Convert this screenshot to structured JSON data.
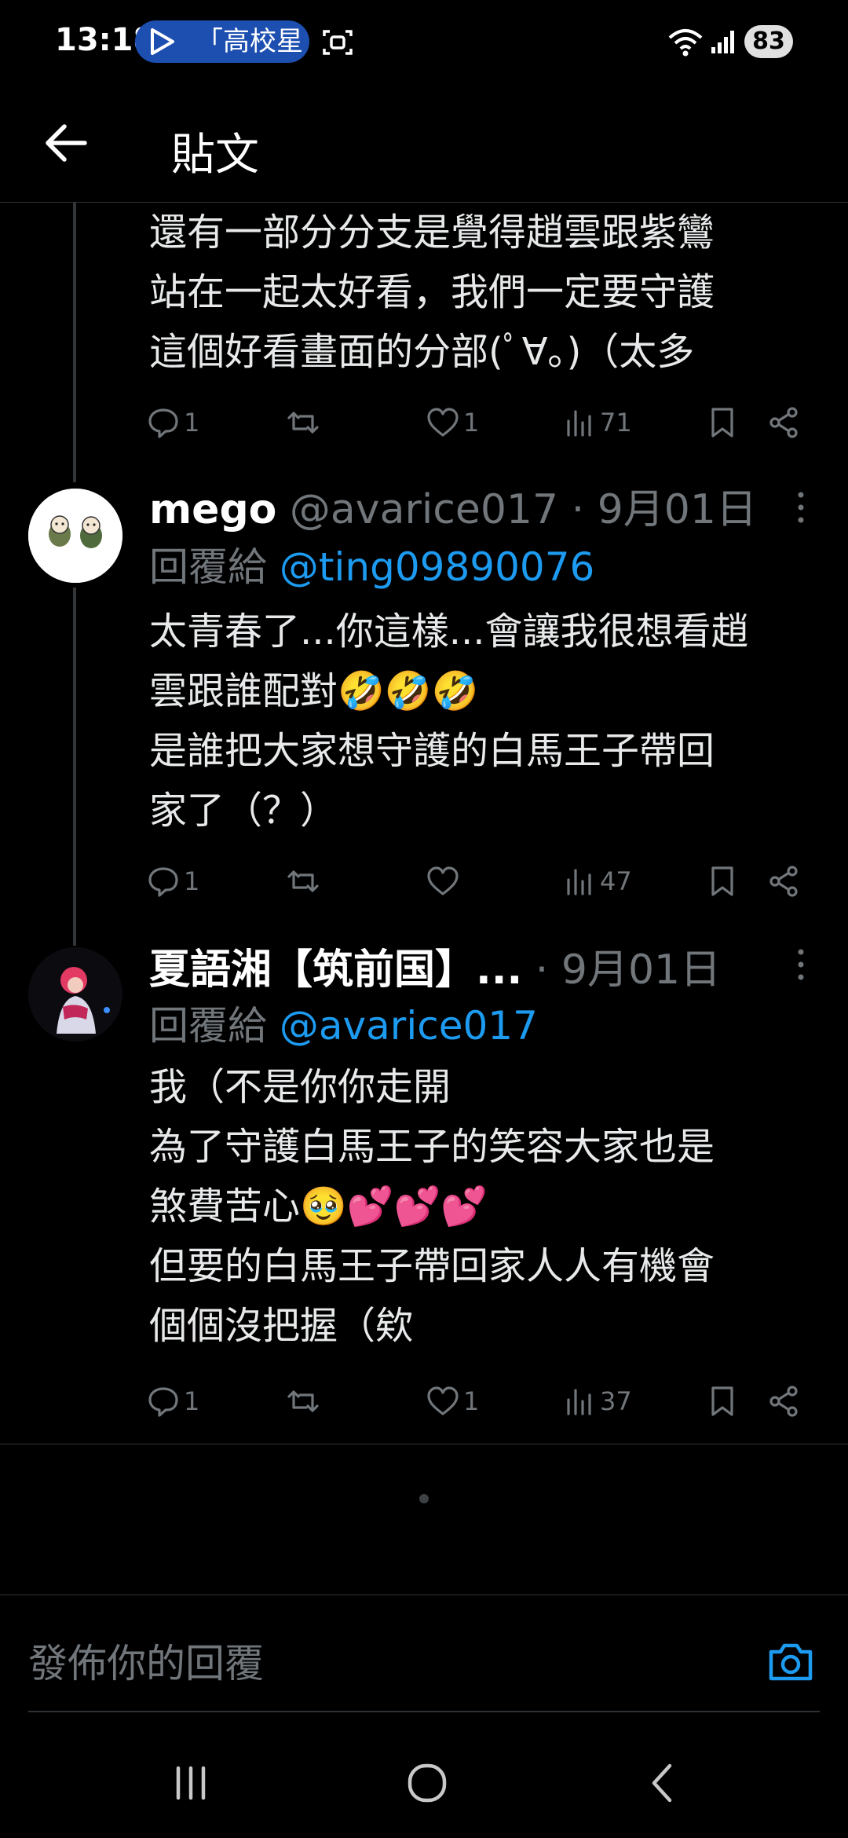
{
  "status_bar": {
    "time": "13:18",
    "notification_pill": "「高校星",
    "battery": "83"
  },
  "header": {
    "title": "貼文"
  },
  "posts": [
    {
      "text_lines": [
        "還有一部分分支是覺得趙雲跟紫鸞",
        "站在一起太好看，我們一定要守護",
        "這個好看畫面的分部(ﾟ∀｡)（太多"
      ],
      "stats": {
        "replies": "1",
        "reposts": "",
        "likes": "1",
        "views": "71"
      }
    },
    {
      "display_name": "mego",
      "handle_time": " @avarice017 · 9月01日",
      "reply_prefix": "回覆給 ",
      "reply_handle": "@ting09890076",
      "text_lines": [
        "太青春了...你這樣...會讓我很想看趙",
        "雲跟誰配對🤣🤣🤣",
        "是誰把大家想守護的白馬王子帶回",
        "家了（？）"
      ],
      "stats": {
        "replies": "1",
        "reposts": "",
        "likes": "",
        "views": "47"
      }
    },
    {
      "display_name": "夏語湘【筑前国】...",
      "handle_time": " · 9月01日",
      "reply_prefix": "回覆給 ",
      "reply_handle": "@avarice017",
      "text_lines": [
        "我（不是你你走開",
        "為了守護白馬王子的笑容大家也是",
        "煞費苦心🥹💕💕💕",
        "但要的白馬王子帶回家人人有機會",
        "個個沒把握（欸"
      ],
      "stats": {
        "replies": "1",
        "reposts": "",
        "likes": "1",
        "views": "37"
      }
    }
  ],
  "composer": {
    "placeholder": "發佈你的回覆"
  },
  "icons": {
    "reply": "reply-icon",
    "repost": "repost-icon",
    "like": "heart-icon",
    "views": "views-icon",
    "bookmark": "bookmark-icon",
    "share": "share-icon",
    "camera": "camera-icon"
  },
  "colors": {
    "background": "#000000",
    "text": "#e7e9ea",
    "muted": "#71767b",
    "link": "#1d9bf0"
  }
}
